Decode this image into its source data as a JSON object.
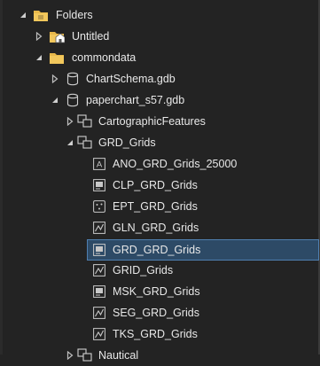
{
  "tree": {
    "folders_label": "Folders",
    "untitled_label": "Untitled",
    "commondata_label": "commondata",
    "chartschema_label": "ChartSchema.gdb",
    "paperchart_label": "paperchart_s57.gdb",
    "cartographic_label": "CartographicFeatures",
    "grd_grids_label": "GRD_Grids",
    "items": [
      {
        "label": "ANO_GRD_Grids_25000",
        "icon": "annotation-icon"
      },
      {
        "label": "CLP_GRD_Grids",
        "icon": "polygon-feature-icon"
      },
      {
        "label": "EPT_GRD_Grids",
        "icon": "point-feature-icon"
      },
      {
        "label": "GLN_GRD_Grids",
        "icon": "line-feature-icon"
      },
      {
        "label": "GRD_GRD_Grids",
        "icon": "polygon-feature-icon"
      },
      {
        "label": "GRID_Grids",
        "icon": "line-feature-icon"
      },
      {
        "label": "MSK_GRD_Grids",
        "icon": "polygon-feature-icon"
      },
      {
        "label": "SEG_GRD_Grids",
        "icon": "line-feature-icon"
      },
      {
        "label": "TKS_GRD_Grids",
        "icon": "line-feature-icon"
      }
    ],
    "next_label": "Nautical"
  },
  "colors": {
    "background": "#232323",
    "selected_bg": "#2d4a66",
    "selected_border": "#4f7fb0",
    "folder_yellow": "#e8b84a",
    "text": "#e8e8e8",
    "icon_gray": "#c8c8c8"
  }
}
